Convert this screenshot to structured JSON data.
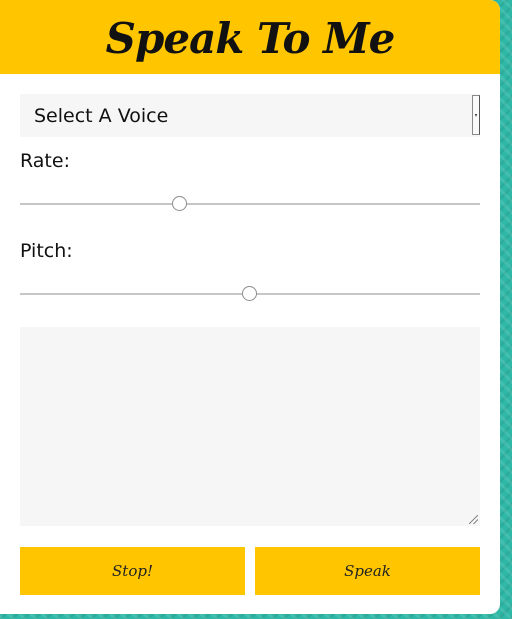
{
  "app": {
    "title": "Speak To Me"
  },
  "voice_select": {
    "selected": "Select A Voice"
  },
  "rate": {
    "label": "Rate:",
    "value_fraction": 0.348
  },
  "pitch": {
    "label": "Pitch:",
    "value_fraction": 0.5
  },
  "text_input": {
    "value": ""
  },
  "buttons": {
    "stop_label": "Stop!",
    "speak_label": "Speak"
  },
  "colors": {
    "accent": "#ffc600",
    "background": "#2fb8a6",
    "field": "#f6f6f6"
  }
}
